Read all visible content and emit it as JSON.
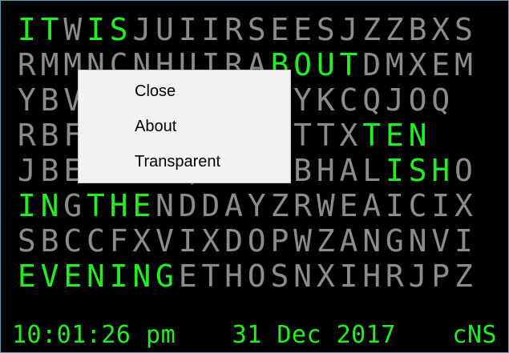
{
  "clock": {
    "rows": [
      "ITWISJUIIRSEESJZZBXS",
      "RMMNCNHUIRABOUTDMXEM",
      "YBVUKJEVKNFUYKCQJOQ",
      "RBFRQVMTSJFDTTXTEN",
      "JBERHMGQRCHFBHALISHO",
      "INGTHENDDAYZRWEAICIX",
      "SBCCFXVIXDOPWZANGNVI",
      "EVENINGETHOSNXIHRJPZ"
    ],
    "highlighted": [
      [
        0,
        1,
        3,
        4
      ],
      [
        11,
        12,
        13,
        14
      ],
      [],
      [
        15,
        16,
        17
      ],
      [
        16,
        17,
        18
      ],
      [
        0,
        1,
        3,
        4,
        5
      ],
      [],
      [
        0,
        1,
        2,
        3,
        4,
        5,
        6
      ]
    ]
  },
  "status": {
    "time": "10:01:26 pm",
    "date": "31 Dec 2017",
    "mode": "cNS"
  },
  "menu": {
    "items": [
      "Close",
      "About",
      "Transparent"
    ]
  },
  "colors": {
    "background": "#000000",
    "lit_letter": "#22ee22",
    "dim_letter": "#8c8c8c",
    "menu_background": "#f2f2f2"
  }
}
